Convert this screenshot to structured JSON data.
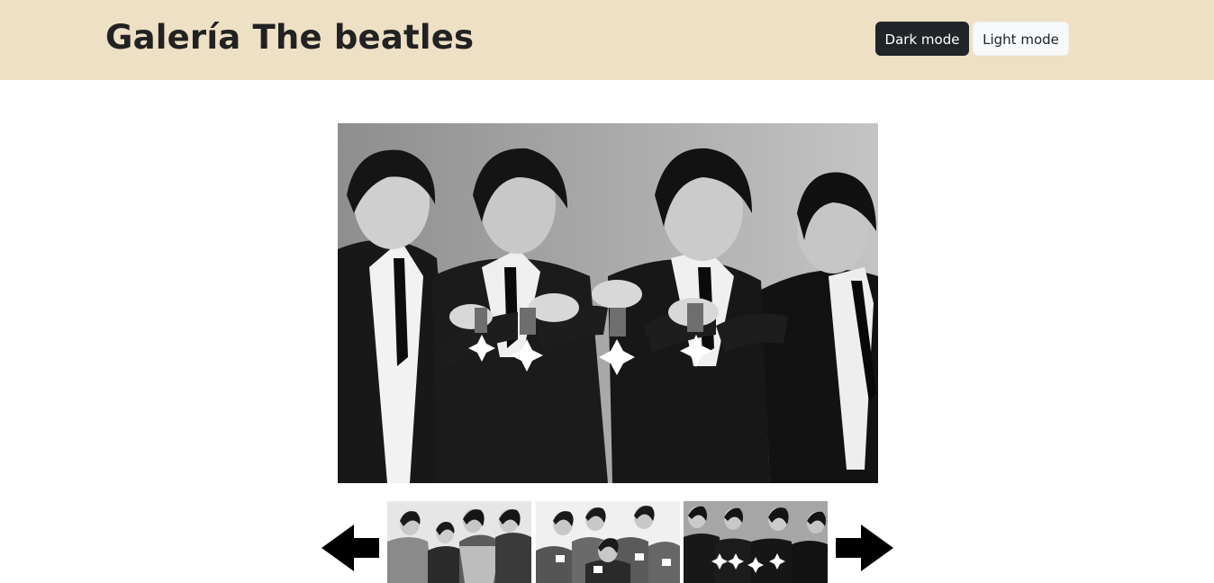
{
  "header": {
    "title": "Galería The beatles",
    "background_color": "#ede0c5"
  },
  "theme_buttons": {
    "dark_label": "Dark mode",
    "light_label": "Light mode"
  },
  "gallery": {
    "main_image": "beatles-holding-medals-photo",
    "thumbnails": [
      "beatles-colorful-jackets-photo",
      "beatles-teacups-photo",
      "beatles-medals-photo"
    ],
    "prev_icon": "arrow-left-icon",
    "next_icon": "arrow-right-icon"
  }
}
